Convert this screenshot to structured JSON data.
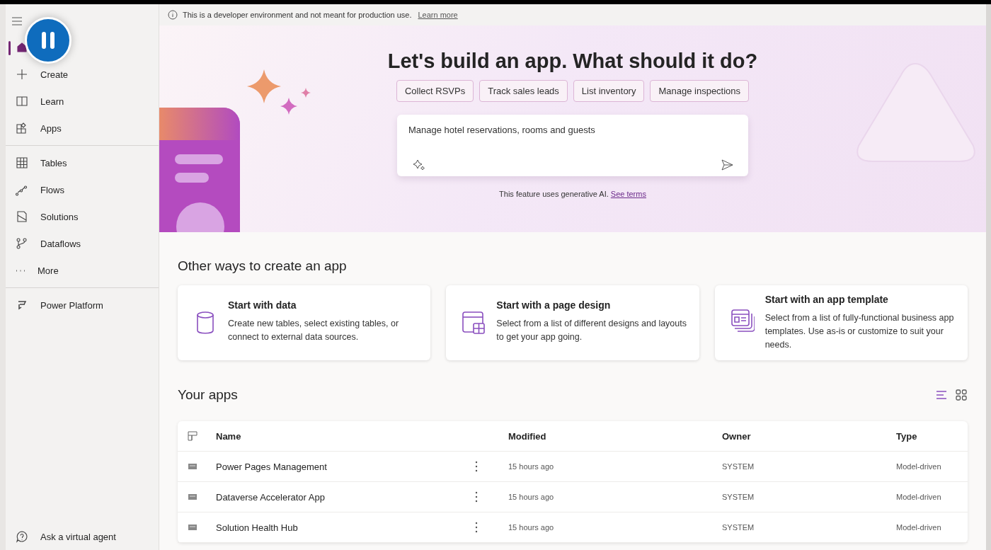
{
  "sidebar": {
    "groups": [
      [
        {
          "kind": "home",
          "selected": true
        },
        {
          "kind": "plus",
          "label": "Create",
          "selected": false
        },
        {
          "kind": "book",
          "label": "Learn",
          "selected": false
        },
        {
          "kind": "apps",
          "label": "Apps",
          "selected": false
        }
      ],
      [
        {
          "kind": "table",
          "label": "Tables",
          "selected": false
        },
        {
          "kind": "flow",
          "label": "Flows",
          "selected": false
        },
        {
          "kind": "solution",
          "label": "Solutions",
          "selected": false
        },
        {
          "kind": "dataflow",
          "label": "Dataflows",
          "selected": false
        },
        {
          "kind": "more",
          "label": "More",
          "selected": false
        }
      ],
      [
        {
          "kind": "platform",
          "label": "Power Platform",
          "selected": false
        }
      ]
    ],
    "footer": {
      "label": "Ask a virtual agent"
    }
  },
  "notice": {
    "text": "This is a developer environment and not meant for production use.",
    "link": "Learn more"
  },
  "hero": {
    "title": "Let's build an app. What should it do?",
    "suggestions": [
      "Collect RSVPs",
      "Track sales leads",
      "List inventory",
      "Manage inspections"
    ],
    "prompt": {
      "value": "Manage hotel reservations, rooms and guests"
    },
    "disclaimer": "This feature uses generative AI.",
    "terms_link": "See terms"
  },
  "other_ways": {
    "title": "Other ways to create an app",
    "cards": [
      {
        "kind": "data",
        "title": "Start with data",
        "text": "Create new tables, select existing tables, or connect to external data sources."
      },
      {
        "kind": "page",
        "title": "Start with a page design",
        "text": "Select from a list of different designs and layouts to get your app going."
      },
      {
        "kind": "template",
        "title": "Start with an app template",
        "text": "Select from a list of fully-functional business app templates. Use as-is or customize to suit your needs."
      }
    ]
  },
  "your_apps": {
    "title": "Your apps",
    "views": [
      {
        "kind": "list",
        "selected": true
      },
      {
        "kind": "grid",
        "selected": false
      }
    ],
    "table": {
      "columns": [
        "Name",
        "Modified",
        "Owner",
        "Type"
      ],
      "rows": [
        {
          "name": "Power Pages Management",
          "modified": "15 hours ago",
          "owner": "SYSTEM",
          "type": "Model-driven"
        },
        {
          "name": "Dataverse Accelerator App",
          "modified": "15 hours ago",
          "owner": "SYSTEM",
          "type": "Model-driven"
        },
        {
          "name": "Solution Health Hub",
          "modified": "15 hours ago",
          "owner": "SYSTEM",
          "type": "Model-driven"
        }
      ]
    }
  },
  "recording": {
    "paused": true
  }
}
